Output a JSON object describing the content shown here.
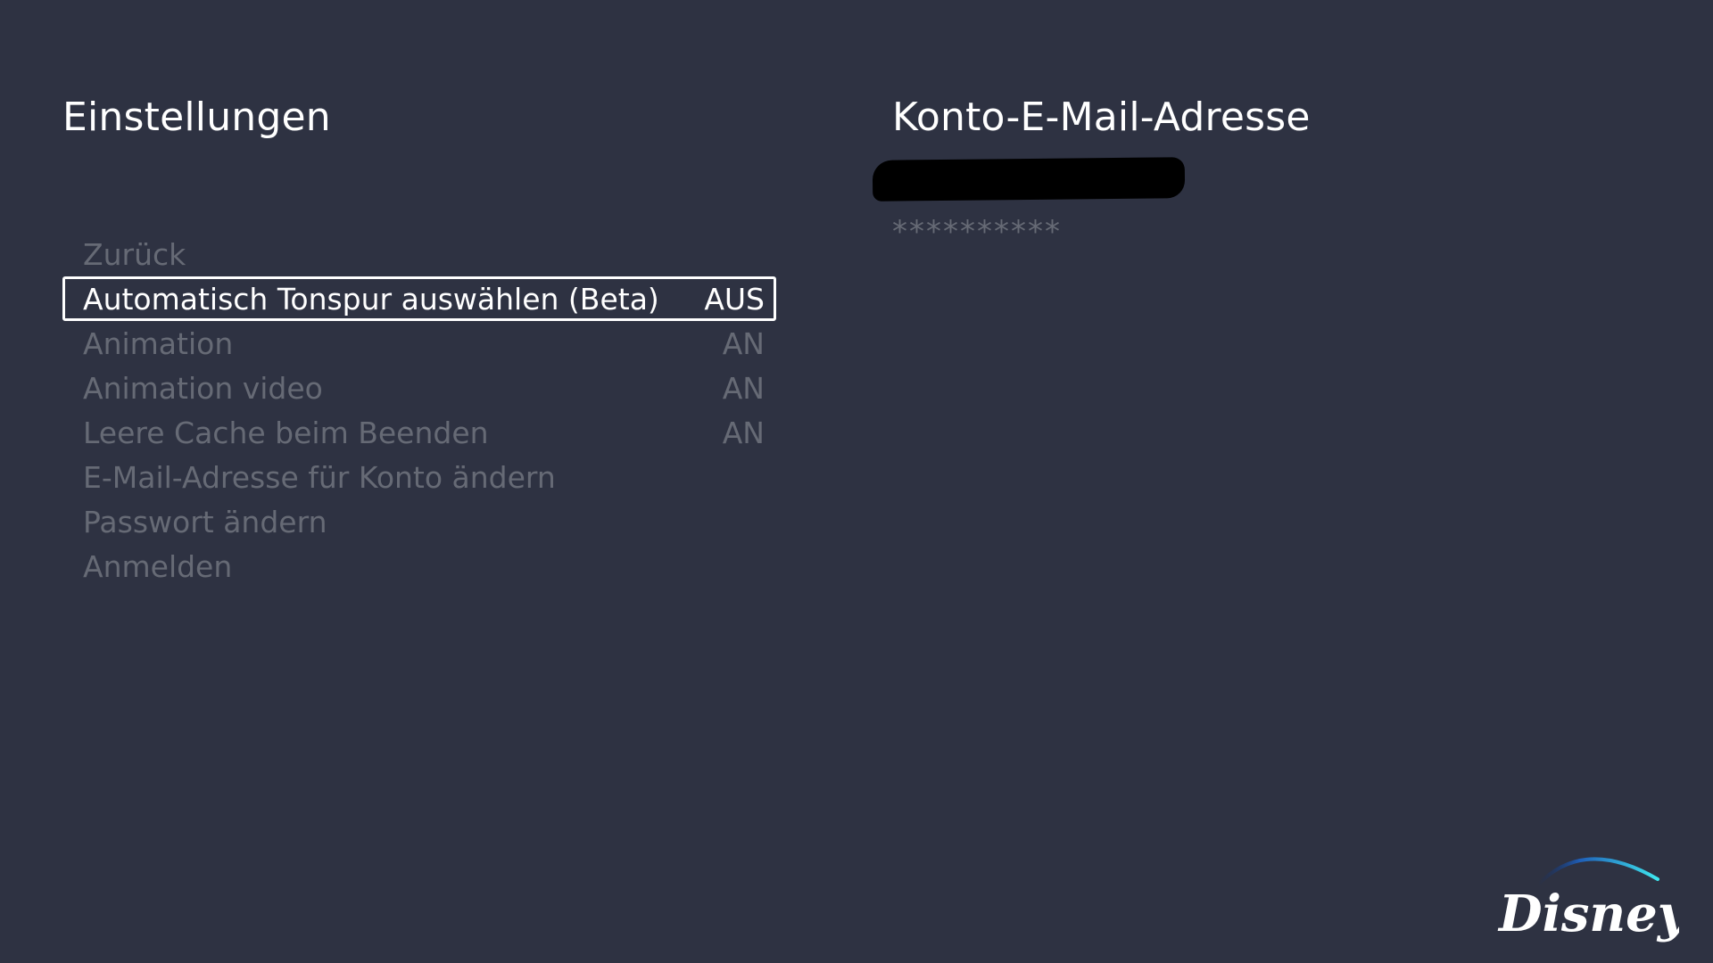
{
  "settings": {
    "title": "Einstellungen",
    "items": [
      {
        "label": "Zurück",
        "value": ""
      },
      {
        "label": "Automatisch Tonspur auswählen (Beta)",
        "value": "AUS",
        "focused": true
      },
      {
        "label": "Animation",
        "value": "AN"
      },
      {
        "label": "Animation video",
        "value": "AN"
      },
      {
        "label": "Leere Cache beim Beenden",
        "value": "AN"
      },
      {
        "label": "E-Mail-Adresse für Konto ändern",
        "value": ""
      },
      {
        "label": "Passwort ändern",
        "value": ""
      },
      {
        "label": "Anmelden",
        "value": ""
      }
    ]
  },
  "account": {
    "title": "Konto-E-Mail-Adresse",
    "password_mask": "**********"
  },
  "logo": {
    "text": "Disney+"
  },
  "colors": {
    "background": "#2e3242",
    "text_primary": "#ffffff",
    "text_dimmed": "#666a75",
    "logo_arc_start": "#0a2a6e",
    "logo_arc_end": "#3ee6ee"
  }
}
